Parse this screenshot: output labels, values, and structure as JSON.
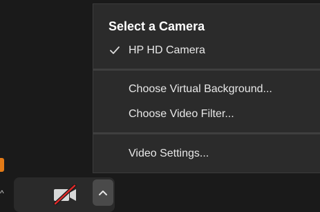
{
  "camera_menu": {
    "header": "Select a Camera",
    "cameras": [
      {
        "label": "HP HD Camera",
        "checked": true
      }
    ],
    "options": [
      {
        "label": "Choose Virtual Background..."
      },
      {
        "label": "Choose Video Filter..."
      }
    ],
    "settings": {
      "label": "Video Settings..."
    }
  },
  "toolbar": {
    "video_state": "off",
    "colors": {
      "mute_slash": "#e02828",
      "accent_orange": "#e37a16"
    }
  }
}
